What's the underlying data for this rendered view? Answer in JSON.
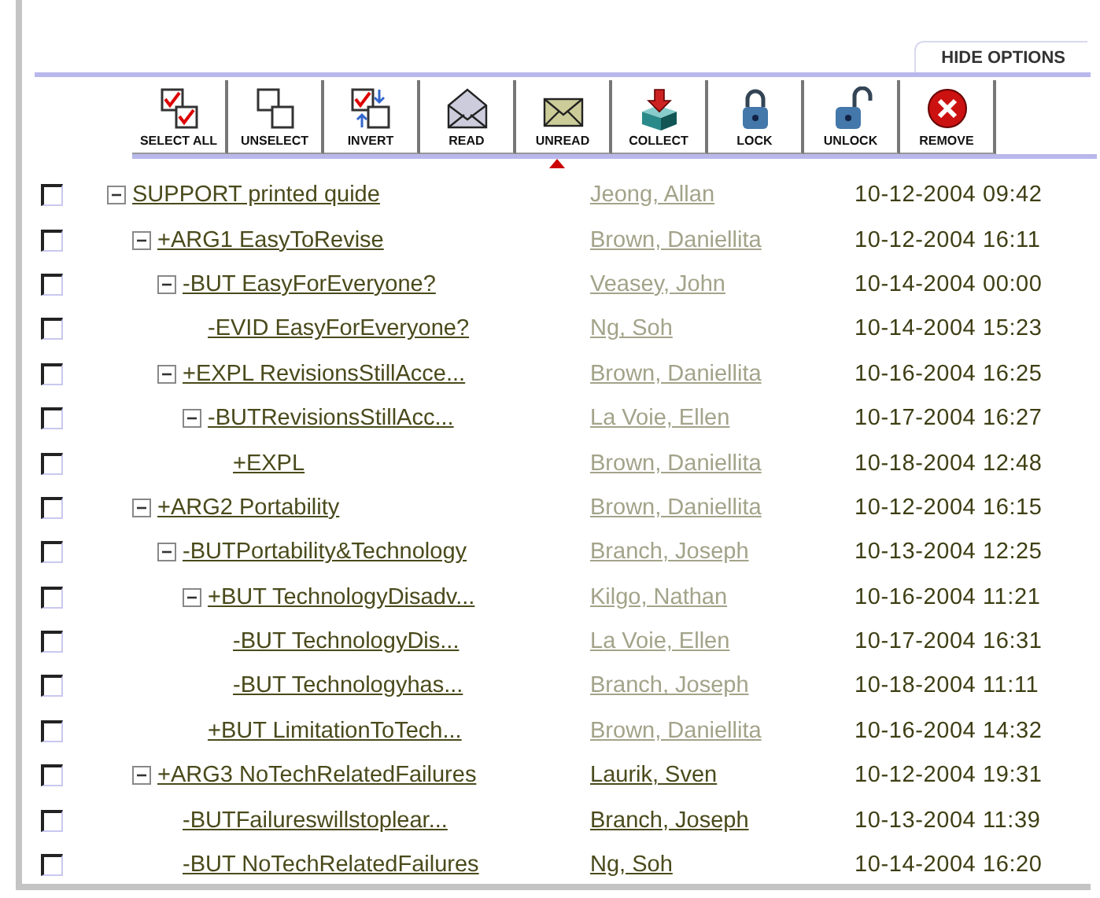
{
  "options_tab": {
    "label": "HIDE OPTIONS"
  },
  "toolbar": [
    {
      "kind": "select-all",
      "label": "SELECT ALL"
    },
    {
      "kind": "unselect",
      "label": "UNSELECT"
    },
    {
      "kind": "invert",
      "label": "INVERT"
    },
    {
      "kind": "read",
      "label": "READ"
    },
    {
      "kind": "unread",
      "label": "UNREAD"
    },
    {
      "kind": "collect",
      "label": "COLLECT"
    },
    {
      "kind": "lock",
      "label": "LOCK"
    },
    {
      "kind": "unlock",
      "label": "UNLOCK"
    },
    {
      "kind": "remove",
      "label": "REMOVE"
    }
  ],
  "messages": [
    {
      "title": "SUPPORT printed quide",
      "author": "Jeong, Allan",
      "read": true,
      "date": "10-12-2004 09:42",
      "checked": false,
      "expanded": true,
      "children": [
        {
          "title": "+ARG1 EasyToRevise",
          "author": "Brown, Daniellita",
          "read": true,
          "date": "10-12-2004 16:11",
          "checked": false,
          "expanded": true,
          "children": [
            {
              "title": "-BUT EasyForEveryone?",
              "author": "Veasey, John",
              "read": true,
              "date": "10-14-2004 00:00",
              "checked": false,
              "expanded": true,
              "children": [
                {
                  "title": "-EVID EasyForEveryone?",
                  "author": "Ng, Soh",
                  "read": true,
                  "date": "10-14-2004 15:23",
                  "checked": false
                }
              ]
            },
            {
              "title": "+EXPL RevisionsStillAcce...",
              "author": "Brown, Daniellita",
              "read": true,
              "date": "10-16-2004 16:25",
              "checked": false,
              "expanded": true,
              "children": [
                {
                  "title": "-BUTRevisionsStillAcc...",
                  "author": "La Voie, Ellen",
                  "read": true,
                  "date": "10-17-2004 16:27",
                  "checked": false,
                  "expanded": true,
                  "children": [
                    {
                      "title": "+EXPL",
                      "author": "Brown, Daniellita",
                      "read": true,
                      "date": "10-18-2004 12:48",
                      "checked": false
                    }
                  ]
                }
              ]
            }
          ]
        },
        {
          "title": "+ARG2 Portability",
          "author": "Brown, Daniellita",
          "read": true,
          "date": "10-12-2004 16:15",
          "checked": false,
          "expanded": true,
          "children": [
            {
              "title": "-BUTPortability&Technology",
              "author": "Branch, Joseph",
              "read": true,
              "date": "10-13-2004 12:25",
              "checked": false,
              "expanded": true,
              "children": [
                {
                  "title": "+BUT TechnologyDisadv...",
                  "author": "Kilgo, Nathan",
                  "read": true,
                  "date": "10-16-2004 11:21",
                  "checked": false,
                  "expanded": true,
                  "children": [
                    {
                      "title": "-BUT TechnologyDis...",
                      "author": "La Voie, Ellen",
                      "read": true,
                      "date": "10-17-2004 16:31",
                      "checked": false
                    },
                    {
                      "title": "-BUT Technologyhas...",
                      "author": "Branch, Joseph",
                      "read": true,
                      "date": "10-18-2004 11:11",
                      "checked": false
                    }
                  ]
                },
                {
                  "title": "+BUT LimitationToTech...",
                  "author": "Brown, Daniellita",
                  "read": true,
                  "date": "10-16-2004 14:32",
                  "checked": false
                }
              ]
            }
          ]
        },
        {
          "title": "+ARG3 NoTechRelatedFailures",
          "author": "Laurik, Sven",
          "read": false,
          "date": "10-12-2004 19:31",
          "checked": false,
          "expanded": true,
          "children": [
            {
              "title": "-BUTFailureswillstoplear...",
              "author": "Branch, Joseph",
              "read": false,
              "date": "10-13-2004 11:39",
              "checked": false
            },
            {
              "title": "-BUT NoTechRelatedFailures",
              "author": "Ng, Soh",
              "read": false,
              "date": "10-14-2004 16:20",
              "checked": false
            }
          ]
        }
      ]
    }
  ]
}
